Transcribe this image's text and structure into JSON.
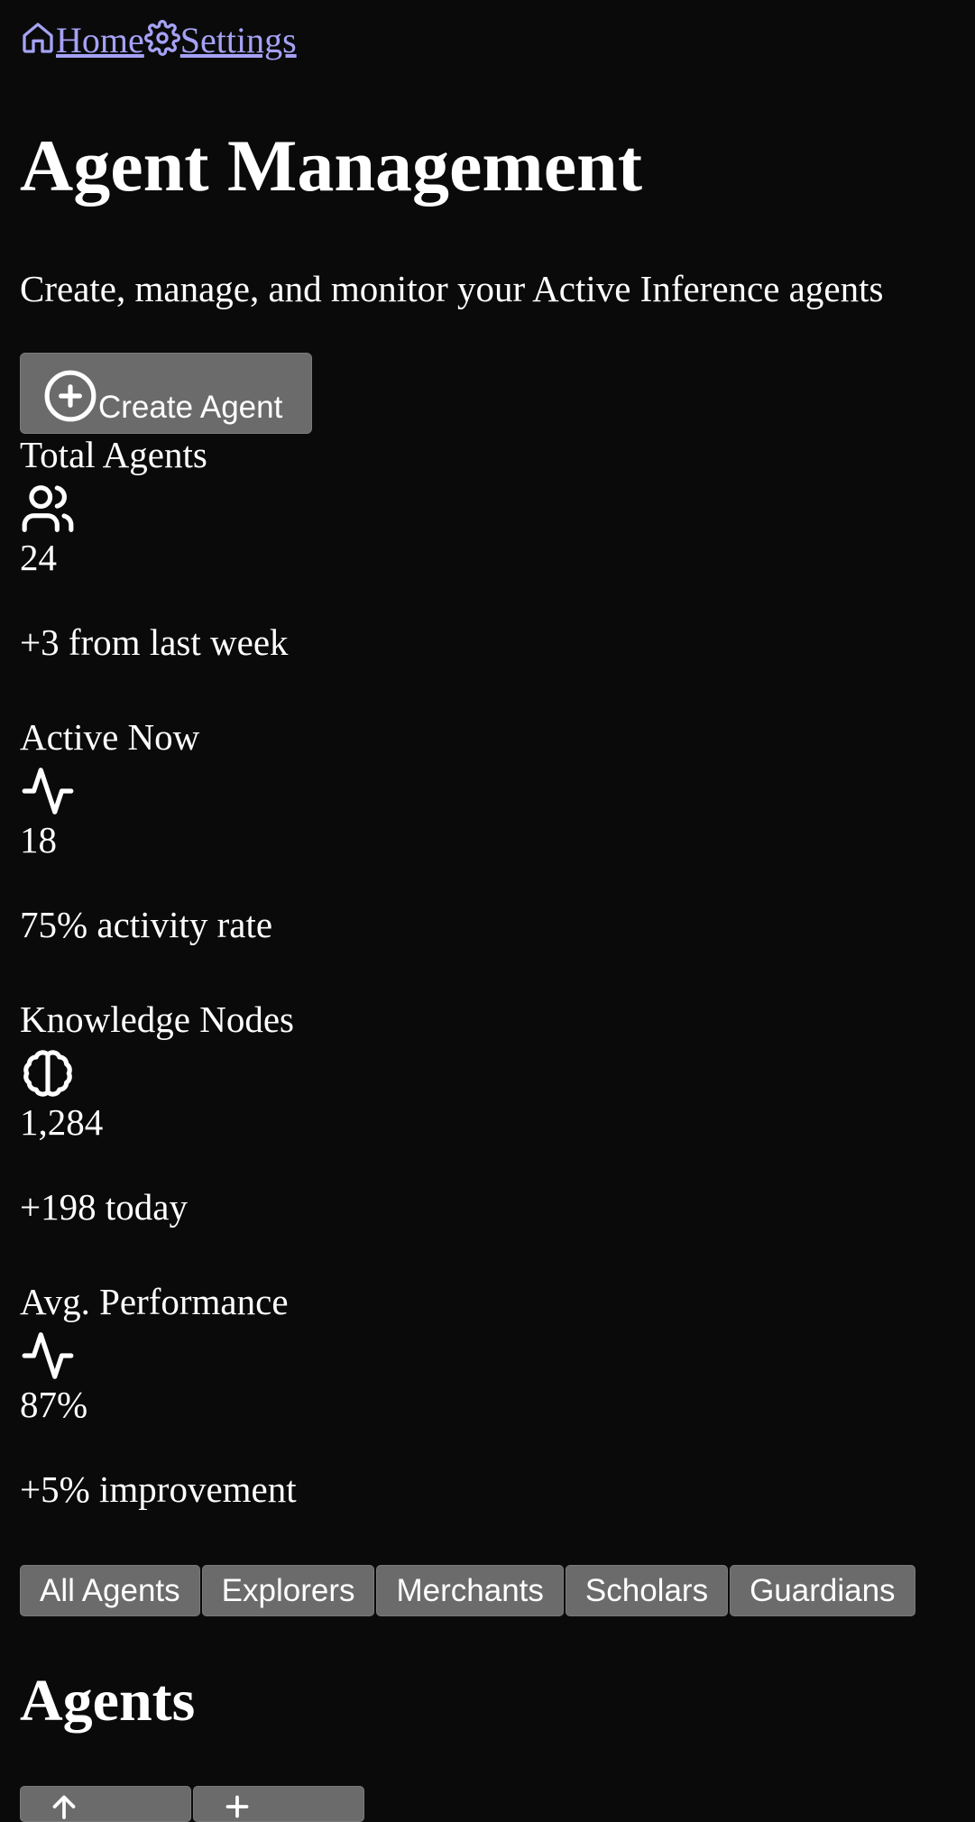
{
  "breadcrumb": {
    "home": {
      "label": "Home",
      "icon": "home-icon"
    },
    "settings": {
      "label": "Settings",
      "icon": "gear-icon"
    }
  },
  "header": {
    "title": "Agent Management",
    "subtitle": "Create, manage, and monitor your Active Inference agents",
    "create_button": {
      "label": "Create Agent",
      "icon": "plus-circle-icon"
    }
  },
  "stats": [
    {
      "label": "Total Agents",
      "icon": "users-icon",
      "value": "24",
      "note": "+3 from last week"
    },
    {
      "label": "Active Now",
      "icon": "activity-icon",
      "value": "18",
      "note": "75% activity rate"
    },
    {
      "label": "Knowledge Nodes",
      "icon": "brain-icon",
      "value": "1,284",
      "note": "+198 today"
    },
    {
      "label": "Avg. Performance",
      "icon": "activity-icon",
      "value": "87%",
      "note": "+5% improvement"
    }
  ],
  "filters": {
    "tabs": [
      "All Agents",
      "Explorers",
      "Merchants",
      "Scholars",
      "Guardians"
    ]
  },
  "agents_section": {
    "title": "Agents"
  },
  "colors": {
    "background": "#0a0a0a",
    "link": "#a5a2f5",
    "button": "#6b6b6b",
    "text": "#ffffff"
  }
}
